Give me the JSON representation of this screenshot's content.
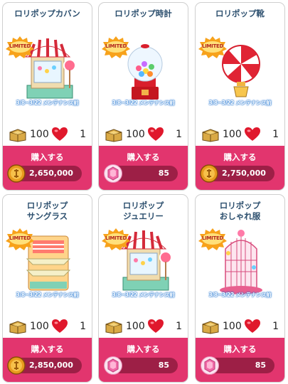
{
  "colors": {
    "accent": "#e2356e",
    "pill": "#9d1f46",
    "title": "#2c4f6e"
  },
  "items": [
    {
      "title": "ロリポップカバン",
      "badge": "LIMITED",
      "period": "3/8~3/22 メンテナンス前",
      "stat_a": "100",
      "stat_b": "1",
      "buy_label": "購入する",
      "currency": "coin",
      "price": "2,650,000",
      "art": "shop"
    },
    {
      "title": "ロリポップ時計",
      "badge": "LIMITED",
      "period": "3/8~3/22 メンテナンス前",
      "stat_a": "100",
      "stat_b": "1",
      "buy_label": "購入する",
      "currency": "gem",
      "price": "85",
      "art": "gumball"
    },
    {
      "title": "ロリポップ靴",
      "badge": "LIMITED",
      "period": "3/8~3/22 メンテナンス前",
      "stat_a": "100",
      "stat_b": "1",
      "buy_label": "購入する",
      "currency": "coin",
      "price": "2,750,000",
      "art": "candy"
    },
    {
      "title": "ロリポップ\nサングラス",
      "badge": "LIMITED",
      "period": "3/8~3/22 メンテナンス前",
      "stat_a": "100",
      "stat_b": "1",
      "buy_label": "購入する",
      "currency": "coin",
      "price": "2,850,000",
      "art": "shelf"
    },
    {
      "title": "ロリポップ\nジュエリー",
      "badge": "LIMITED",
      "period": "3/8~3/22 メンテナンス前",
      "stat_a": "100",
      "stat_b": "1",
      "buy_label": "購入する",
      "currency": "gem",
      "price": "85",
      "art": "shop"
    },
    {
      "title": "ロリポップ\nおしゃれ服",
      "badge": "LIMITED",
      "period": "3/8~3/22 メンテナンス前",
      "stat_a": "100",
      "stat_b": "1",
      "buy_label": "購入する",
      "currency": "gem",
      "price": "85",
      "art": "cage"
    }
  ]
}
